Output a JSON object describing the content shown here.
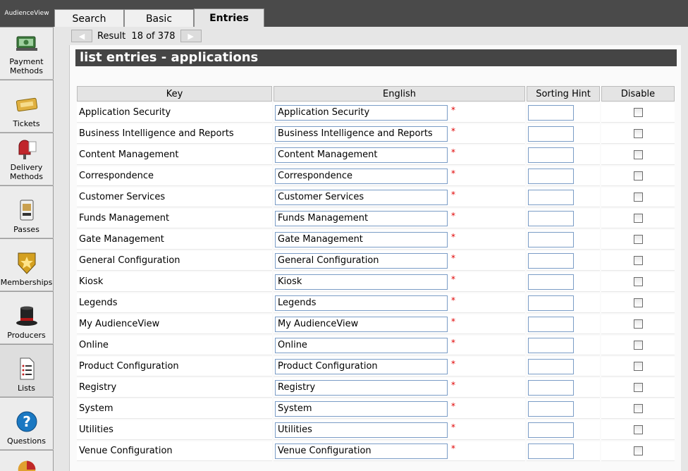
{
  "brand": "AudienceView",
  "tabs": [
    {
      "label": "Search"
    },
    {
      "label": "Basic"
    },
    {
      "label": "Entries"
    }
  ],
  "sidebar": {
    "items": [
      {
        "label": "Payment\nMethods",
        "icon": "money-icon"
      },
      {
        "label": "Tickets",
        "icon": "ticket-icon"
      },
      {
        "label": "Delivery\nMethods",
        "icon": "mailbox-icon"
      },
      {
        "label": "Passes",
        "icon": "pass-icon"
      },
      {
        "label": "Memberships",
        "icon": "star-badge-icon"
      },
      {
        "label": "Producers",
        "icon": "top-hat-icon"
      },
      {
        "label": "Lists",
        "icon": "list-icon"
      },
      {
        "label": "Questions",
        "icon": "question-icon"
      }
    ]
  },
  "nav": {
    "result_text": "Result  18 of 378"
  },
  "panel": {
    "title": "list entries - applications",
    "columns": [
      "Key",
      "English",
      "Sorting Hint",
      "Disable"
    ],
    "required_marker": "*",
    "rows": [
      {
        "key": "Application Security",
        "english": "Application Security"
      },
      {
        "key": "Business Intelligence and Reports",
        "english": "Business Intelligence and Reports"
      },
      {
        "key": "Content Management",
        "english": "Content Management"
      },
      {
        "key": "Correspondence",
        "english": "Correspondence"
      },
      {
        "key": "Customer Services",
        "english": "Customer Services"
      },
      {
        "key": "Funds Management",
        "english": "Funds Management"
      },
      {
        "key": "Gate Management",
        "english": "Gate Management"
      },
      {
        "key": "General Configuration",
        "english": "General Configuration"
      },
      {
        "key": "Kiosk",
        "english": "Kiosk"
      },
      {
        "key": "Legends",
        "english": "Legends"
      },
      {
        "key": "My AudienceView",
        "english": "My AudienceView"
      },
      {
        "key": "Online",
        "english": "Online"
      },
      {
        "key": "Product Configuration",
        "english": "Product Configuration"
      },
      {
        "key": "Registry",
        "english": "Registry"
      },
      {
        "key": "System",
        "english": "System"
      },
      {
        "key": "Utilities",
        "english": "Utilities"
      },
      {
        "key": "Venue Configuration",
        "english": "Venue Configuration"
      }
    ]
  },
  "colors": {
    "header_bar": "#454545",
    "required": "#e00000",
    "input_border": "#7a9cc6"
  }
}
